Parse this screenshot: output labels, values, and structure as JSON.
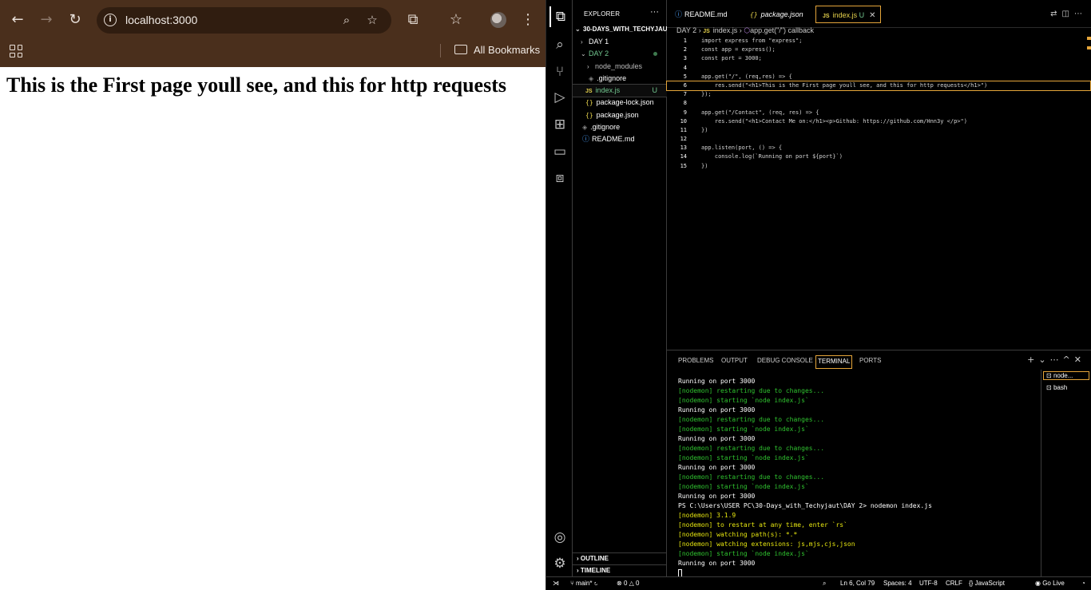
{
  "browser": {
    "nav": {
      "back": "←",
      "forward": "→",
      "reload": "↻"
    },
    "url": "localhost:3000",
    "bookmarks_label": "All Bookmarks",
    "page_heading": "This is the First page youll see, and this for http requests"
  },
  "explorer": {
    "title": "EXPLORER",
    "more": "···",
    "root": "30-DAYS_WITH_TECHYJAUT",
    "items": [
      {
        "label": "DAY 1"
      },
      {
        "label": "DAY 2"
      },
      {
        "label": "node_modules"
      },
      {
        "label": ".gitignore"
      },
      {
        "label": "index.js",
        "badge": "U"
      },
      {
        "label": "package-lock.json"
      },
      {
        "label": "package.json"
      },
      {
        "label": ".gitignore"
      },
      {
        "label": "README.md"
      }
    ],
    "outline": "OUTLINE",
    "timeline": "TIMELINE"
  },
  "editor": {
    "tabs": [
      {
        "label": "README.md"
      },
      {
        "label": "package.json"
      },
      {
        "label": "index.js",
        "badge": "U"
      }
    ],
    "breadcrumb": [
      "DAY 2",
      "index.js",
      "app.get(\"/\") callback"
    ],
    "lines": [
      "import express from \"express\";",
      "const app = express();",
      "const port = 3000;",
      "",
      "app.get(\"/\", (req,res) => {",
      "    res.send(\"<h1>This is the First page youll see, and this for http requests</h1>\")",
      "});",
      "",
      "app.get(\"/Contact\", (req, res) => {",
      "    res.send(\"<h1>Contact Me on:</h1><p>Github: https://github.com/Hnn3y </p>\")",
      "})",
      "",
      "app.listen(port, () => {",
      "    console.log(`Running on port ${port}`)",
      "})"
    ]
  },
  "panel": {
    "tabs": [
      "PROBLEMS",
      "OUTPUT",
      "DEBUG CONSOLE",
      "TERMINAL",
      "PORTS"
    ],
    "terminal_lines": [
      "Running on port 3000",
      "[nodemon] restarting due to changes...",
      "[nodemon] starting `node index.js`",
      "Running on port 3000",
      "[nodemon] restarting due to changes...",
      "[nodemon] starting `node index.js`",
      "Running on port 3000",
      "[nodemon] restarting due to changes...",
      "[nodemon] starting `node index.js`",
      "Running on port 3000",
      "[nodemon] restarting due to changes...",
      "[nodemon] starting `node index.js`",
      "Running on port 3000",
      "PS C:\\Users\\USER PC\\30-Days_with_Techyjaut\\DAY 2> nodemon index.js",
      "[nodemon] 3.1.9",
      "[nodemon] to restart at any time, enter `rs`",
      "[nodemon] watching path(s): *.*",
      "[nodemon] watching extensions: js,mjs,cjs,json",
      "[nodemon] starting `node index.js`",
      "Running on port 3000"
    ],
    "terminals": [
      "node...",
      "bash"
    ]
  },
  "statusbar": {
    "branch": "main*",
    "problems": "0 △ 0",
    "position": "Ln 6, Col 79",
    "spaces": "Spaces: 4",
    "encoding": "UTF-8",
    "eol": "CRLF",
    "language": "JavaScript",
    "golive": "Go Live"
  },
  "colors": {
    "accent": "#e5a53a",
    "browser_frame": "#4a2f1c",
    "terminal_green": "#2fc22f"
  }
}
